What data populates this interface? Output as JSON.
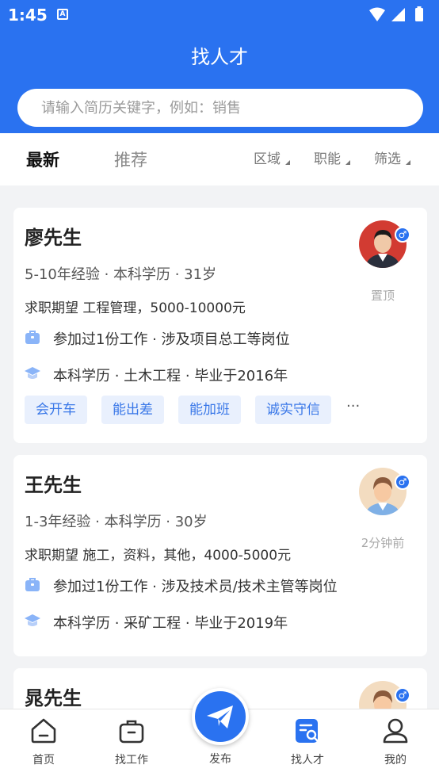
{
  "status": {
    "time": "1:45",
    "notify_icon": "A"
  },
  "header": {
    "title": "找人才"
  },
  "search": {
    "placeholder": "请输入简历关键字，例如：销售"
  },
  "tabs": {
    "active": "最新",
    "inactive": "推荐"
  },
  "filters": [
    "区域",
    "职能",
    "筛选"
  ],
  "colors": {
    "primary": "#2a72f0",
    "tag_bg": "#e9f0fd",
    "tag_text": "#3a78e8"
  },
  "candidates": [
    {
      "name": "廖先生",
      "info": "5-10年经验 · 本科学历 · 31岁",
      "expect": "求职期望 工程管理，5000-10000元",
      "work": "参加过1份工作 · 涉及项目总工等岗位",
      "edu": "本科学历 · 土木工程 · 毕业于2016年",
      "meta": "置顶",
      "gender": "♂",
      "tags": [
        "会开车",
        "能出差",
        "能加班",
        "诚实守信"
      ],
      "more": "···"
    },
    {
      "name": "王先生",
      "info": "1-3年经验 · 本科学历 · 30岁",
      "expect": "求职期望 施工，资料，其他，4000-5000元",
      "work": "参加过1份工作 · 涉及技术员/技术主管等岗位",
      "edu": "本科学历 · 采矿工程 · 毕业于2019年",
      "meta": "2分钟前",
      "gender": "♂"
    },
    {
      "name": "晁先生",
      "gender": "♂"
    }
  ],
  "tabbar": {
    "home": "首页",
    "jobs": "找工作",
    "publish": "发布",
    "talent": "找人才",
    "mine": "我的"
  }
}
